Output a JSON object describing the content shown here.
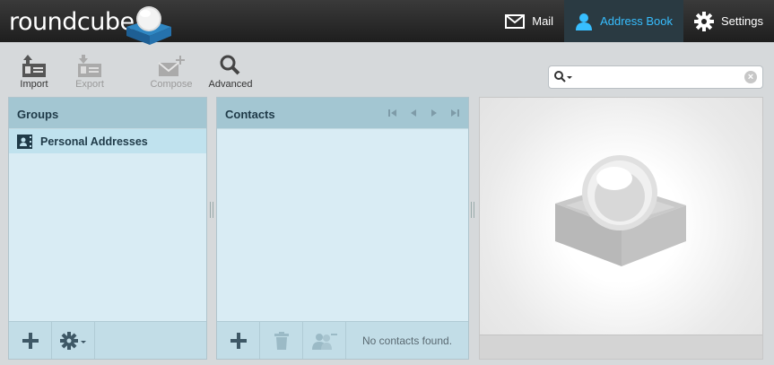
{
  "app": {
    "logo_text": "roundcube"
  },
  "nav": {
    "mail": "Mail",
    "addressbook": "Address Book",
    "settings": "Settings"
  },
  "toolbar": {
    "import": "Import",
    "export": "Export",
    "compose": "Compose",
    "advanced": "Advanced"
  },
  "search": {
    "value": "",
    "placeholder": ""
  },
  "groups": {
    "title": "Groups",
    "items": [
      {
        "label": "Personal Addresses"
      }
    ]
  },
  "contacts": {
    "title": "Contacts",
    "empty_message": "No contacts found."
  },
  "colors": {
    "accent": "#37beff",
    "panel_bg": "#d9ecf4",
    "panel_header": "#a3c6d2",
    "topbar": "#2b2b2b"
  }
}
